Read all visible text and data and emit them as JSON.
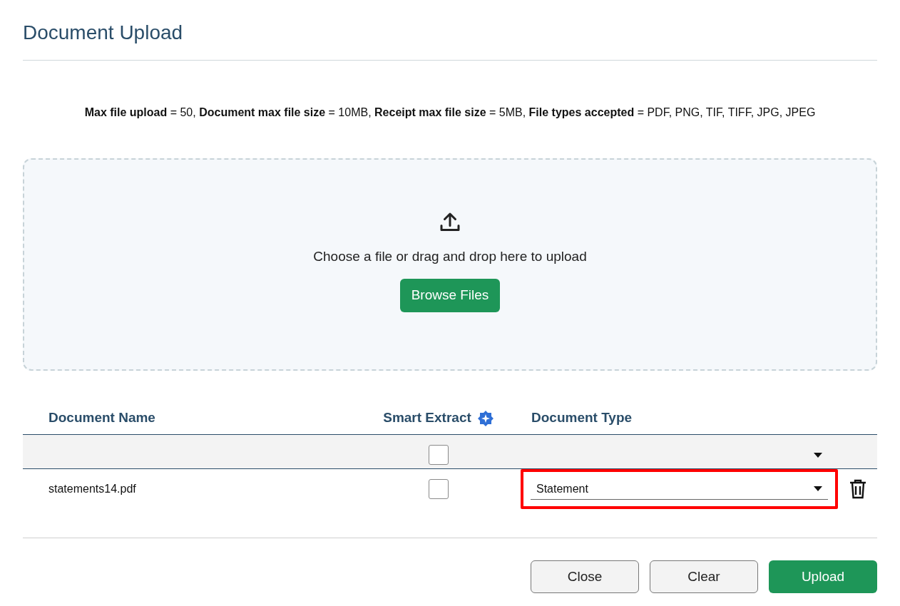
{
  "title": "Document Upload",
  "info": "**Max file upload** = 50,  **Document max file size** = 10MB,  **Receipt max file size** = 5MB,  **File types accepted** = PDF, PNG, TIF, TIFF, JPG, JPEG",
  "dropzone": {
    "prompt": "Choose a file or drag and drop here to upload",
    "button": "Browse Files"
  },
  "table": {
    "columns": [
      "Document Name",
      "Smart Extract",
      "Document Type"
    ],
    "rows": [
      {
        "kind": "filter",
        "smart_extract_checked": false,
        "document_type": "",
        "highlighted": false
      },
      {
        "kind": "file",
        "name": "statements14.pdf",
        "smart_extract_checked": false,
        "document_type": "Statement",
        "highlighted": true
      }
    ]
  },
  "buttons": [
    {
      "label": "Close",
      "kind": "secondary"
    },
    {
      "label": "Clear",
      "kind": "secondary"
    },
    {
      "label": "Upload",
      "kind": "primary"
    }
  ]
}
